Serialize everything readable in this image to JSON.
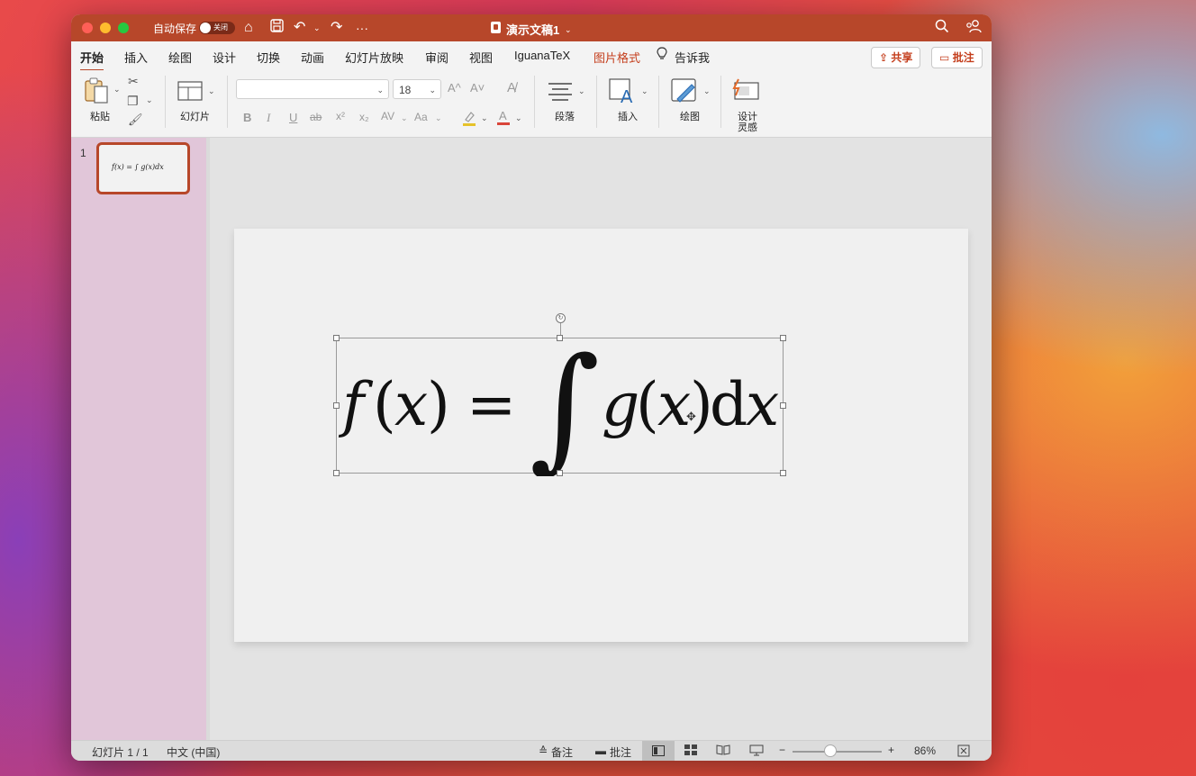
{
  "titlebar": {
    "autosave_label": "自动保存",
    "autosave_state": "关闭",
    "doc_title": "演示文稿1",
    "icons": [
      "home-icon",
      "save-icon",
      "undo-icon",
      "redo-icon",
      "more-icon",
      "search-icon",
      "share-people-icon"
    ]
  },
  "ribbon": {
    "tabs": [
      "开始",
      "插入",
      "绘图",
      "设计",
      "切换",
      "动画",
      "幻灯片放映",
      "审阅",
      "视图",
      "IguanaTeX",
      "图片格式",
      "告诉我"
    ],
    "active_tab": "开始",
    "share_label": "共享",
    "comment_label": "批注",
    "paste_label": "粘贴",
    "slides_label": "幻灯片",
    "font_name": "",
    "font_size": "18",
    "paragraph_label": "段落",
    "insert_label": "插入",
    "draw_label": "绘图",
    "design_ideas_label_1": "设计",
    "design_ideas_label_2": "灵感",
    "format": {
      "bold": "B",
      "italic": "I",
      "underline": "U",
      "strike": "ab",
      "superscript": "x²",
      "subscript": "x₂",
      "spacing": "AV",
      "case": "Aa",
      "grow": "A^",
      "shrink": "A˅"
    }
  },
  "thumbnail": {
    "number": "1",
    "equation": "f(x) = ∫ g(x)dx"
  },
  "slide": {
    "equation_parts": {
      "f": "f",
      "lp1": "(",
      "x1": "x",
      "rp1": ")",
      "eq": "=",
      "int": "∫",
      "g": "g",
      "lp2": "(",
      "x2": "x",
      "rp2": ")",
      "d": "d",
      "x3": "x"
    }
  },
  "statusbar": {
    "slide_count": "幻灯片 1 / 1",
    "language": "中文 (中国)",
    "notes_label": "备注",
    "comments_label": "批注",
    "zoom_minus": "−",
    "zoom_plus": "+",
    "zoom_level": "86%",
    "zoom_fraction": 0.43
  },
  "colors": {
    "accent": "#b7472a",
    "accent_text": "#c43e1c"
  }
}
